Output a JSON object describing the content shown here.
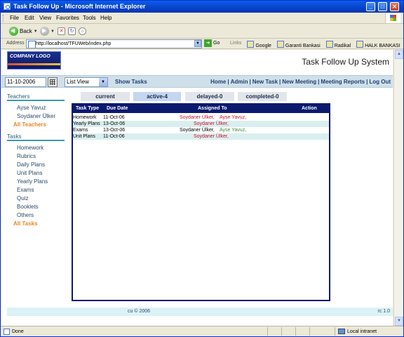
{
  "window": {
    "title": "Task Follow Up - Microsoft Internet Explorer"
  },
  "menu": [
    "File",
    "Edit",
    "View",
    "Favorites",
    "Tools",
    "Help"
  ],
  "toolbar": {
    "back_label": "Back"
  },
  "address": {
    "label": "Address",
    "url": "http://localhost/TFUWeb/index.php",
    "go_label": "Go",
    "links_label": "Links",
    "links": [
      "Google",
      "Garanti Bankasi",
      "Radikal",
      "HALK BANKASI"
    ]
  },
  "header": {
    "logo_text": "COMPANY LOGO",
    "system_title": "Task Follow Up System"
  },
  "nav": {
    "date": "11-10-2006",
    "view_select": "List View",
    "show_tasks": "Show Tasks",
    "links": [
      "Home",
      "Admin",
      "New Task",
      "New Meeting",
      "Meeting Reports",
      "Log Out"
    ]
  },
  "sidebar": {
    "teachers_heading": "Teachers",
    "teachers": [
      "Ayse Yavuz",
      "Soydaner Ülker"
    ],
    "all_teachers": "All Teachers",
    "tasks_heading": "Tasks",
    "tasks": [
      "Homework",
      "Rubrics",
      "Daily Plans",
      "Unit Plans",
      "Yearly Plans",
      "Exams",
      "Quiz",
      "Booklets",
      "Others"
    ],
    "all_tasks": "All Tasks"
  },
  "tabs": [
    "current",
    "active-4",
    "delayed-0",
    "completed-0"
  ],
  "table": {
    "headers": [
      "Task Type",
      "Due Date",
      "Assigned To",
      "Action"
    ],
    "rows": [
      {
        "type": "Homework",
        "due": "11-Oct-06",
        "a1": "Soydaner Ülker,",
        "a2": "Ayse Yavuz,",
        "a1_color": "red",
        "a2_color": "red"
      },
      {
        "type": "Yearly Plans",
        "due": "13-Oct-06",
        "a1": "Soydaner Ülker,",
        "a2": "",
        "a1_color": "red",
        "a2_color": ""
      },
      {
        "type": "Exams",
        "due": "13-Oct-06",
        "a1": "Soydaner Ülker,",
        "a2": "Ayse Yavuz,",
        "a1_color": "black",
        "a2_color": "green"
      },
      {
        "type": "Unit Plans",
        "due": "11-Oct-06",
        "a1": "Soydaner Ülker,",
        "a2": "",
        "a1_color": "red",
        "a2_color": ""
      }
    ]
  },
  "footer": {
    "copyright": "cu © 2006",
    "version": "rc 1.0"
  },
  "status": {
    "text": "Done",
    "zone": "Local intranet"
  }
}
